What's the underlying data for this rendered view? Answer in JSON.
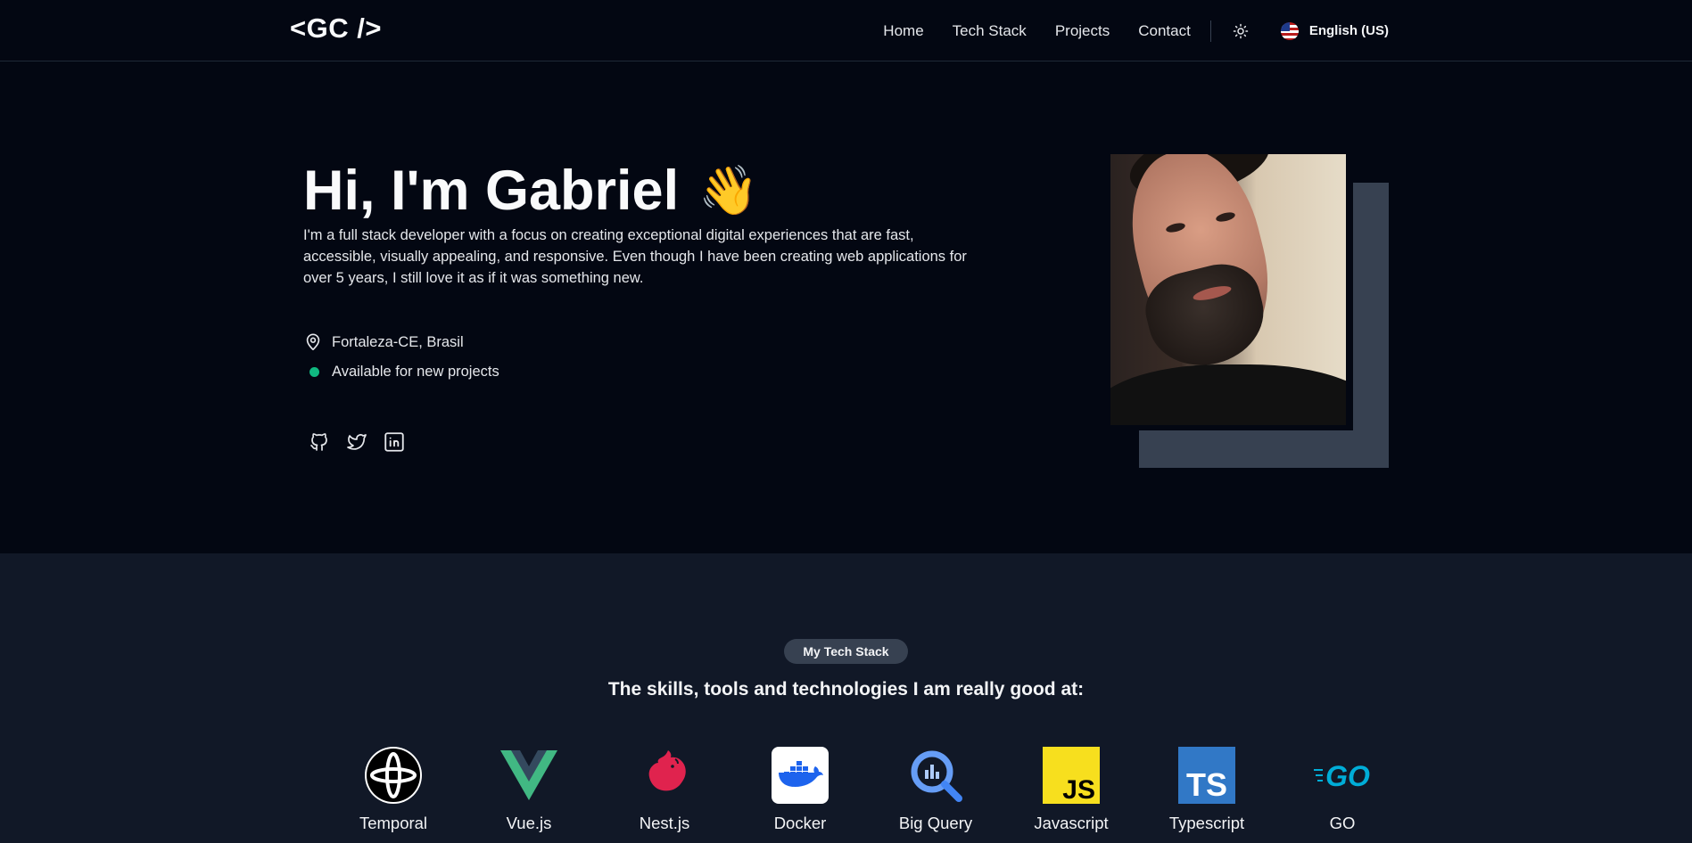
{
  "header": {
    "logo": "<GC />",
    "nav": [
      {
        "label": "Home"
      },
      {
        "label": "Tech Stack"
      },
      {
        "label": "Projects"
      },
      {
        "label": "Contact"
      }
    ],
    "theme_icon": "sun-icon",
    "language": "English (US)",
    "language_icon": "us-flag-icon"
  },
  "hero": {
    "title": "Hi, I'm Gabriel",
    "emoji": "👋",
    "description": "I'm a full stack developer with a focus on creating exceptional digital experiences that are fast, accessible, visually appealing, and responsive. Even though I have been creating web applications for over 5 years, I still love it as if it was something new.",
    "location": "Fortaleza-CE, Brasil",
    "location_icon": "map-pin-icon",
    "availability": "Available for new projects",
    "availability_color": "#10b981",
    "socials": [
      {
        "icon": "github-icon"
      },
      {
        "icon": "twitter-icon"
      },
      {
        "icon": "linkedin-icon"
      }
    ]
  },
  "stack": {
    "badge": "My Tech Stack",
    "subtitle": "The skills, tools and technologies I am really good at:",
    "items": [
      {
        "label": "Temporal",
        "icon": "temporal-icon"
      },
      {
        "label": "Vue.js",
        "icon": "vuejs-icon"
      },
      {
        "label": "Nest.js",
        "icon": "nestjs-icon"
      },
      {
        "label": "Docker",
        "icon": "docker-icon"
      },
      {
        "label": "Big Query",
        "icon": "bigquery-icon"
      },
      {
        "label": "Javascript",
        "icon": "javascript-icon"
      },
      {
        "label": "Typescript",
        "icon": "typescript-icon"
      },
      {
        "label": "GO",
        "icon": "go-icon"
      }
    ]
  },
  "colors": {
    "background": "#030712",
    "section_background": "#111827",
    "photo_shadow": "#374151",
    "javascript_yellow": "#f7df1e",
    "typescript_blue": "#3178c6",
    "vue_green": "#41b883",
    "nest_red": "#e0234e",
    "docker_blue": "#1d63ed",
    "go_cyan": "#00add8"
  }
}
